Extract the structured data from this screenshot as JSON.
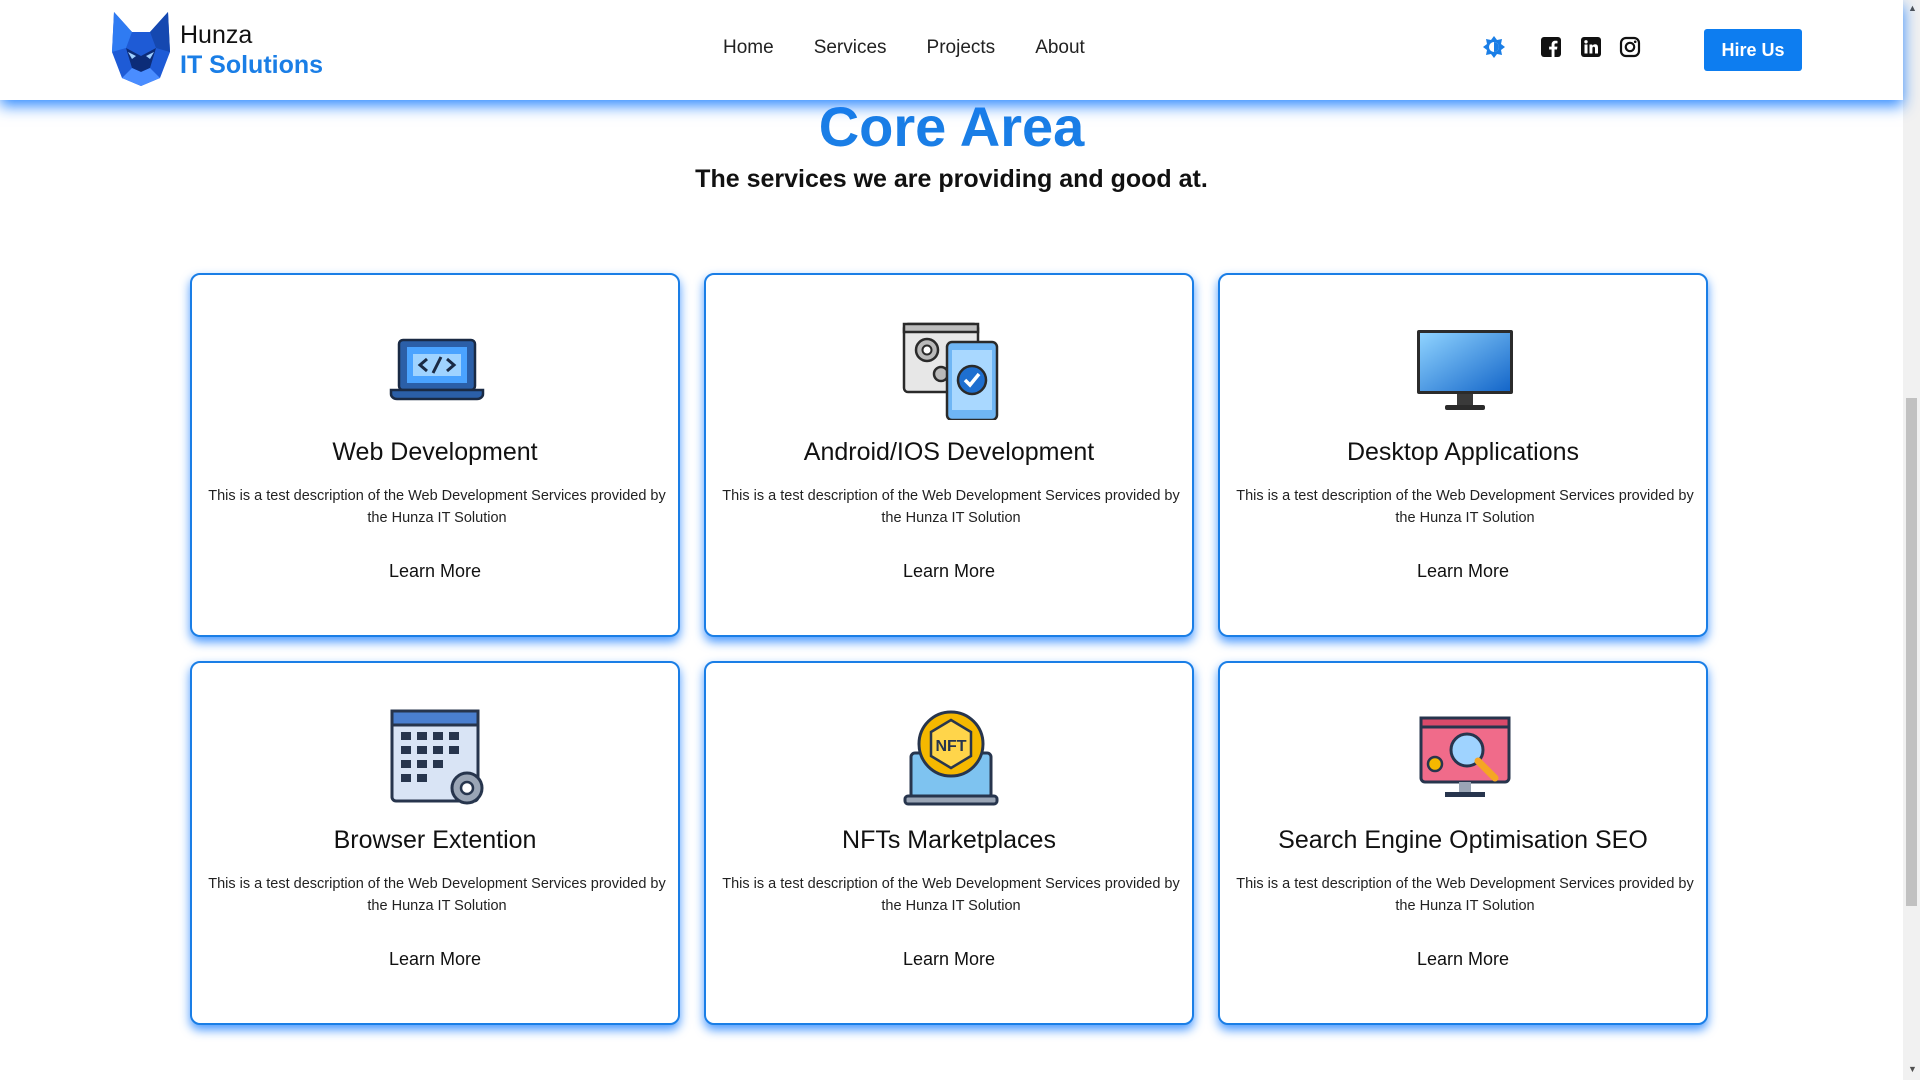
{
  "header": {
    "brand_top": "Hunza",
    "brand_bottom": "IT Solutions",
    "nav": [
      "Home",
      "Services",
      "Projects",
      "About"
    ],
    "hire_label": "Hire Us",
    "accent_color": "#1a7ee6",
    "social_icons": [
      "facebook-icon",
      "linkedin-icon",
      "instagram-icon"
    ],
    "theme_icon": "brightness-icon"
  },
  "section": {
    "title": "Core Area",
    "subtitle": "The services we are providing and good at."
  },
  "cards": [
    {
      "title": "Web Development",
      "desc": "This is a test description of the Web Development Services provided by the Hunza IT Solution",
      "link": "Learn More",
      "icon": "laptop-code-icon"
    },
    {
      "title": "Android/IOS Development",
      "desc": "This is a test description of the Web Development Services provided by the Hunza IT Solution",
      "link": "Learn More",
      "icon": "mobile-devices-icon"
    },
    {
      "title": "Desktop Applications",
      "desc": "This is a test description of the Web Development Services provided by the Hunza IT Solution",
      "link": "Learn More",
      "icon": "monitor-icon"
    },
    {
      "title": "Browser Extention",
      "desc": "This is a test description of the Web Development Services provided by the Hunza IT Solution",
      "link": "Learn More",
      "icon": "browser-extension-icon"
    },
    {
      "title": "NFTs Marketplaces",
      "desc": "This is a test description of the Web Development Services provided by the Hunza IT Solution",
      "link": "Learn More",
      "icon": "nft-icon"
    },
    {
      "title": "Search Engine Optimisation SEO",
      "desc": "This is a test description of the Web Development Services provided by the Hunza IT Solution",
      "link": "Learn More",
      "icon": "seo-icon"
    }
  ]
}
